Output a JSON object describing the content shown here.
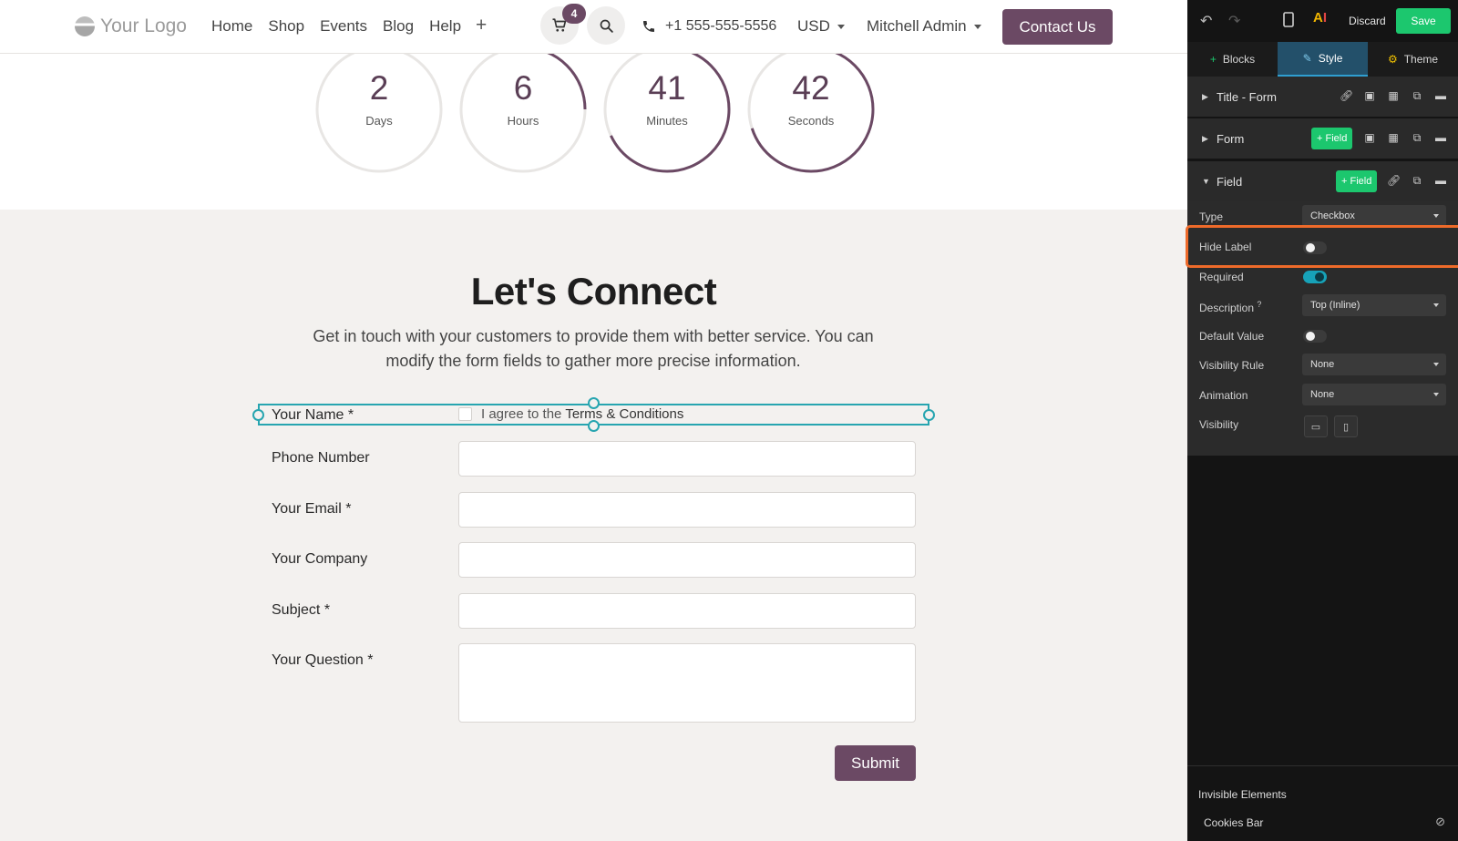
{
  "nav": {
    "logo_text": "Your Logo",
    "links": [
      "Home",
      "Shop",
      "Events",
      "Blog",
      "Help"
    ],
    "plus": "+",
    "cart_count": "4",
    "phone": "+1 555-555-5556",
    "currency": "USD",
    "user": "Mitchell Admin",
    "contact_label": "Contact Us"
  },
  "countdown": [
    {
      "value": "2",
      "unit": "Days",
      "progress": 0.0
    },
    {
      "value": "6",
      "unit": "Hours",
      "progress": 0.25
    },
    {
      "value": "41",
      "unit": "Minutes",
      "progress": 0.68
    },
    {
      "value": "42",
      "unit": "Seconds",
      "progress": 0.7
    }
  ],
  "form": {
    "heading": "Let's Connect",
    "subtitle": "Get in touch with your customers to provide them with better service. You can modify the form fields to gather more precise information.",
    "selected_label": "Your Name *",
    "agree_prefix": "I agree to the",
    "agree_terms": "Terms & Conditions",
    "fields": [
      {
        "label": "Phone Number"
      },
      {
        "label": "Your Email *"
      },
      {
        "label": "Your Company"
      },
      {
        "label": "Subject *"
      },
      {
        "label": "Your Question *"
      }
    ],
    "submit_label": "Submit"
  },
  "panel": {
    "discard": "Discard",
    "save": "Save",
    "tabs": [
      "Blocks",
      "Style",
      "Theme"
    ],
    "sections": {
      "title_form": "Title - Form",
      "form": "Form",
      "field": "Field",
      "add_field": "+ Field"
    },
    "options": {
      "type_label": "Type",
      "type_value": "Checkbox",
      "hide_label": "Hide Label",
      "hide_label_on": false,
      "required_label": "Required",
      "required_on": true,
      "description_label": "Description",
      "description_help": "?",
      "description_value": "Top (Inline)",
      "default_value_label": "Default Value",
      "default_value_on": false,
      "visibility_rule_label": "Visibility Rule",
      "visibility_rule_value": "None",
      "animation_label": "Animation",
      "animation_value": "None",
      "visibility_label": "Visibility"
    },
    "invisible": {
      "title": "Invisible Elements",
      "item": "Cookies Bar"
    }
  },
  "colors": {
    "brand": "#6b4964",
    "accent_teal": "#27a5b0",
    "save_green": "#1cc76e",
    "highlight_orange": "#ee6a2a"
  }
}
